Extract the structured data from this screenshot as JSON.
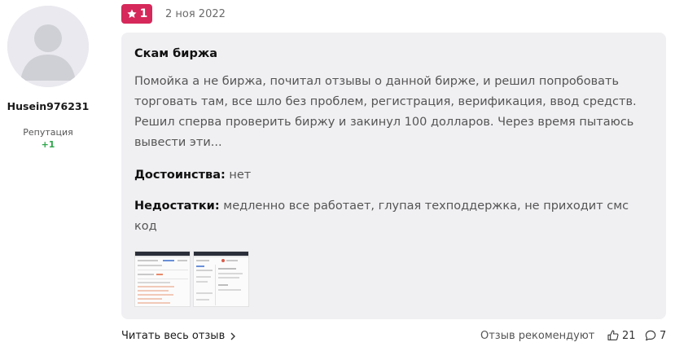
{
  "author": {
    "name": "Husein976231",
    "reputation_label": "Репутация",
    "reputation_value": "+1",
    "avatar_icon": "default-user-avatar-icon"
  },
  "review": {
    "rating": "1",
    "rating_icon": "star-icon",
    "date": "2 ноя 2022",
    "title": "Скам биржа",
    "text": "Помойка а не биржа, почитал отзывы о данной бирже, и решил попробовать торговать там, все шло без проблем, регистрация, верификация, ввод средств. Решил сперва проверить биржу и закинул 100 долларов. Через время пытаюсь вывести эти...",
    "pros_label": "Достоинства:",
    "pros_value": "нет",
    "cons_label": "Недостатки:",
    "cons_value": "медленно все работает, глупая техподдержка, не приходит смс код"
  },
  "footer": {
    "read_more": "Читать весь отзыв",
    "recommend": "Отзыв рекомендуют",
    "likes": "21",
    "comments": "7"
  },
  "colors": {
    "badge": "#d6285a",
    "reputation": "#2ea64a",
    "card_bg": "#f0f0f3"
  }
}
